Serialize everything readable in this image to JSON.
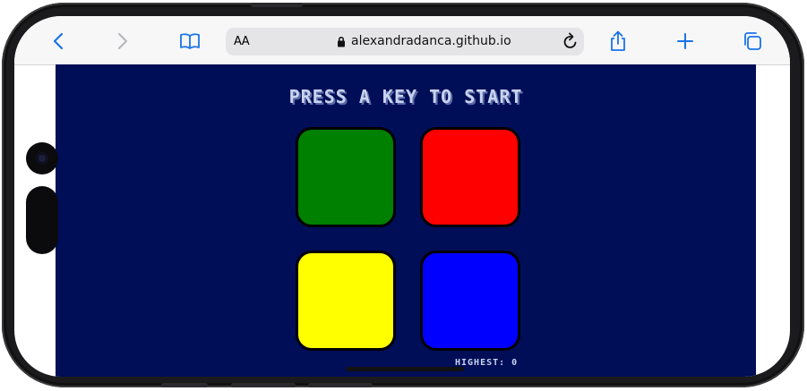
{
  "browser": {
    "url": "alexandradanca.github.io",
    "text_size_label": "AA"
  },
  "game": {
    "title": "PRESS A KEY TO START",
    "highest_label": "HIGHEST: 0",
    "tiles": [
      {
        "name": "green",
        "color": "#008000"
      },
      {
        "name": "red",
        "color": "#ff0000"
      },
      {
        "name": "yellow",
        "color": "#ffff00"
      },
      {
        "name": "blue",
        "color": "#0000ff"
      }
    ]
  }
}
